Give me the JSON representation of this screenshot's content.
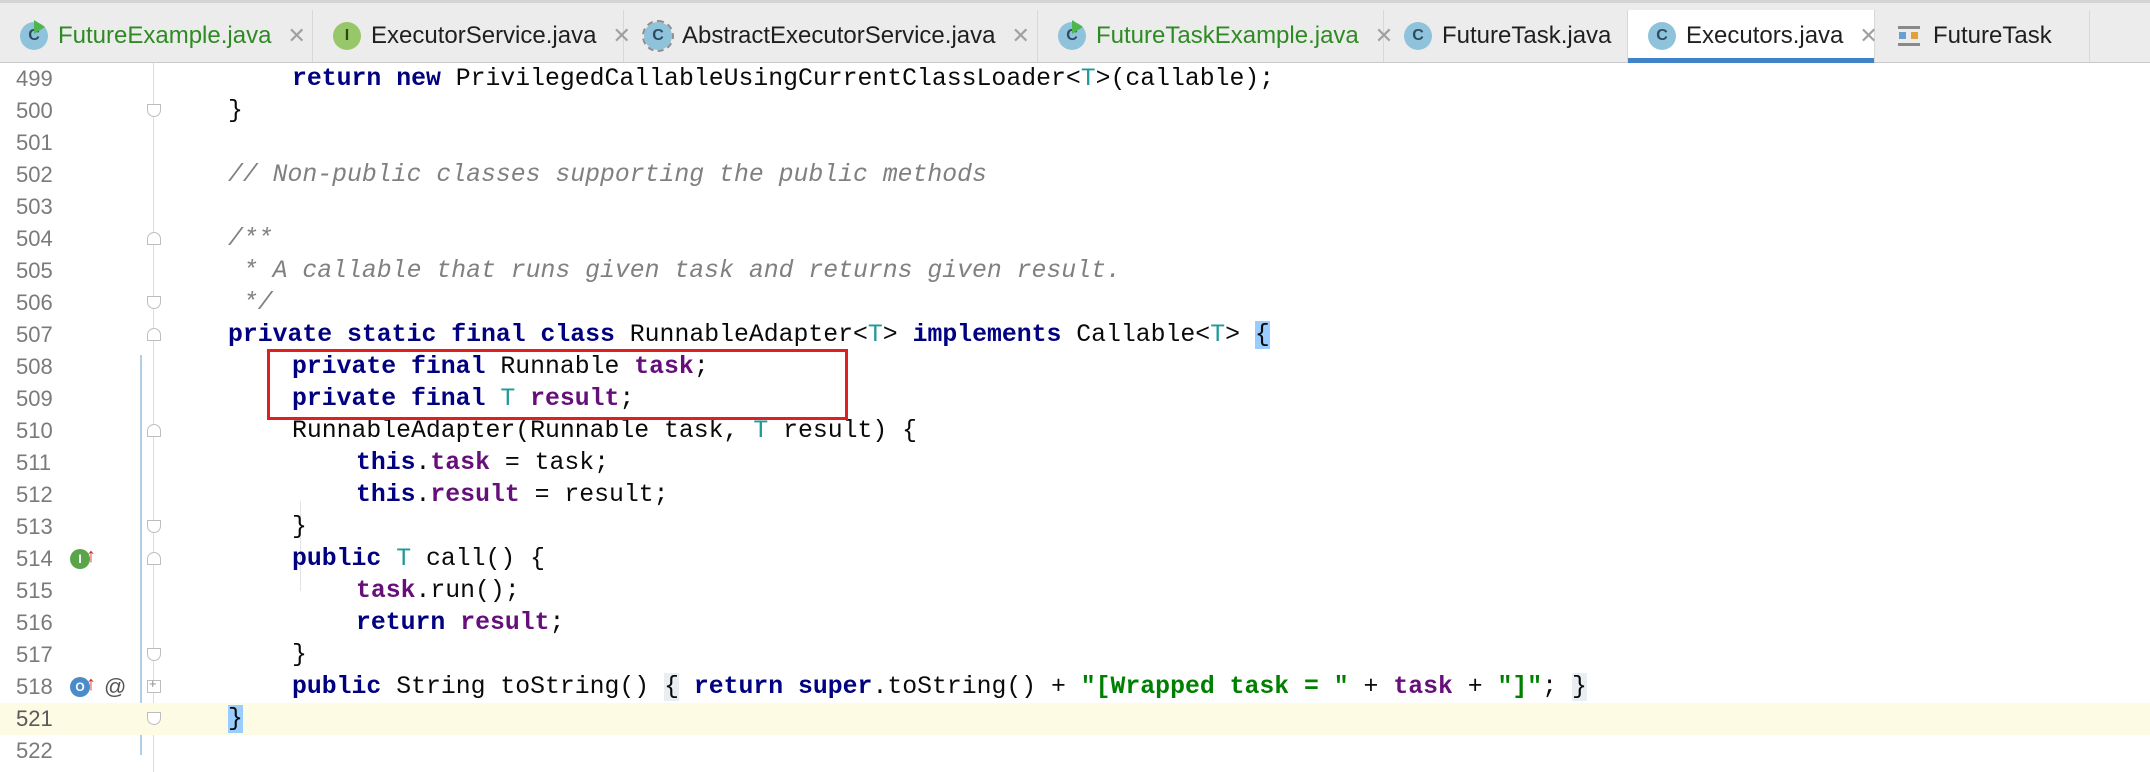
{
  "tabs": [
    {
      "label": "FutureExample.java",
      "icon": "class-run-icon",
      "green": true,
      "closable": true
    },
    {
      "label": "ExecutorService.java",
      "icon": "interface-icon",
      "green": false,
      "closable": true
    },
    {
      "label": "AbstractExecutorService.java",
      "icon": "abstract-class-icon",
      "green": false,
      "closable": true
    },
    {
      "label": "FutureTaskExample.java",
      "icon": "class-run-icon",
      "green": true,
      "closable": true
    },
    {
      "label": "FutureTask.java",
      "icon": "class-icon",
      "green": false,
      "closable": true
    },
    {
      "label": "Executors.java",
      "icon": "class-icon",
      "green": false,
      "closable": true,
      "active": true
    },
    {
      "label": "FutureTask",
      "icon": "structure-icon",
      "green": false,
      "closable": false
    }
  ],
  "close_glyph": "✕",
  "line_numbers": [
    "499",
    "500",
    "501",
    "502",
    "503",
    "504",
    "505",
    "506",
    "507",
    "508",
    "509",
    "510",
    "511",
    "512",
    "513",
    "514",
    "515",
    "516",
    "517",
    "518",
    "521",
    "522"
  ],
  "code": {
    "l499": [
      "return",
      "new",
      "PrivilegedCallableUsingCurrentClassLoader<",
      "T",
      ">(callable);"
    ],
    "l500": "}",
    "l502": "// Non-public classes supporting the public methods",
    "l504": "/**",
    "l505": " * A callable that runs given task and returns given result.",
    "l506": " */",
    "l507": [
      "private static final class",
      "RunnableAdapter<",
      "T",
      ">",
      "implements",
      "Callable<",
      "T",
      ">",
      "{"
    ],
    "l508": [
      "private final",
      "Runnable",
      "task",
      ";"
    ],
    "l509": [
      "private final",
      "T",
      "result",
      ";"
    ],
    "l510": [
      "RunnableAdapter(Runnable task,",
      "T",
      "result) {"
    ],
    "l511": [
      "this",
      ".",
      "task",
      "= task;"
    ],
    "l512": [
      "this",
      ".",
      "result",
      "= result;"
    ],
    "l513": "}",
    "l514": [
      "public",
      "T",
      "call() {"
    ],
    "l515": [
      "task",
      ".run();"
    ],
    "l516": [
      "return",
      "result",
      ";"
    ],
    "l517": "}",
    "l518": [
      "public",
      "String toString()",
      "{",
      "return",
      "super",
      ".toString() +",
      "\"[Wrapped task = \"",
      "+",
      "task",
      "+",
      "\"]\"",
      ";",
      "}"
    ],
    "l521": "}"
  },
  "gutter_markers": {
    "l514": "implementation-icon",
    "l518": "override-icon",
    "l518_annotation": "@"
  },
  "colors": {
    "keyword": "#000080",
    "type_param": "#20999d",
    "field": "#660e7a",
    "string": "#008000",
    "comment": "#808080",
    "active_tab_underline": "#4083c9",
    "highlight_box": "#e02020"
  }
}
